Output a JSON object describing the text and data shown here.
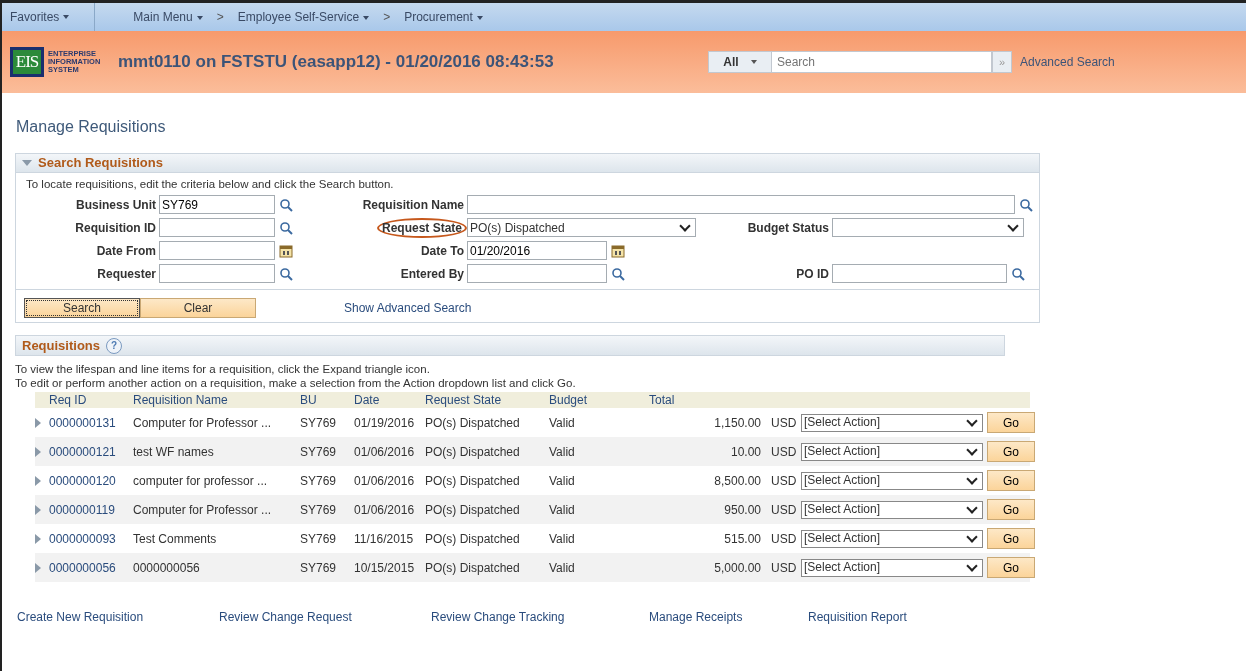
{
  "nav": {
    "favorites": "Favorites",
    "breadcrumbs": [
      "Main Menu",
      "Employee Self-Service",
      "Procurement"
    ],
    "separators": [
      ">",
      ">"
    ]
  },
  "header": {
    "logo_mark": "EIS",
    "logo_lines": [
      "ENTERPRISE",
      "INFORMATION",
      "SYSTEM"
    ],
    "title": "mmt0110 on FSTSTU (easapp12) - 01/20/2016 08:43:53",
    "search_scope": "All",
    "search_placeholder": "Search",
    "search_go": "»",
    "advanced_search": "Advanced Search"
  },
  "page_title": "Manage Requisitions",
  "search_panel": {
    "title": "Search Requisitions",
    "expanded": true,
    "instructions": "To locate requisitions, edit the criteria below and click the Search button.",
    "rows": [
      [
        {
          "label": "Business Unit",
          "value": "SY769",
          "kind": "lookup",
          "highlighted": false
        },
        {
          "label": "Requisition Name",
          "kind": "lookup",
          "highlighted": false
        }
      ],
      [
        {
          "label": "Requisition ID",
          "kind": "lookup",
          "highlighted": false
        },
        {
          "label": "Request State",
          "value": "PO(s) Dispatched",
          "kind": "select",
          "highlighted": true
        },
        {
          "label": "Budget Status",
          "kind": "select",
          "highlighted": false
        }
      ],
      [
        {
          "label": "Date From",
          "kind": "date",
          "highlighted": false
        },
        {
          "label": "Date To",
          "value": "01/20/2016",
          "kind": "date",
          "highlighted": false
        }
      ],
      [
        {
          "label": "Requester",
          "kind": "lookup",
          "highlighted": false
        },
        {
          "label": "Entered By",
          "kind": "lookup",
          "highlighted": false
        },
        {
          "label": "PO ID",
          "kind": "lookup",
          "highlighted": false
        }
      ]
    ],
    "buttons": [
      "Search",
      "Clear"
    ],
    "advanced_link": "Show Advanced Search"
  },
  "requisitions": {
    "title": "Requisitions",
    "help": "?",
    "instructions": [
      "To view the lifespan and line items for a requisition, click the Expand triangle icon.",
      "To edit or perform another action on a requisition, make a selection from the Action dropdown list and click Go."
    ],
    "columns": [
      "Req ID",
      "Requisition Name",
      "BU",
      "Date",
      "Request State",
      "Budget",
      "Total"
    ],
    "rows": [
      {
        "req_id": "0000000131",
        "name": "Computer for Professor ...",
        "bu": "SY769",
        "date": "01/19/2016",
        "state": "PO(s) Dispatched",
        "budget": "Valid",
        "total": "1,150.00",
        "currency": "USD",
        "action": "[Select Action]",
        "go": "Go",
        "expanded": false
      },
      {
        "req_id": "0000000121",
        "name": "test WF names",
        "bu": "SY769",
        "date": "01/06/2016",
        "state": "PO(s) Dispatched",
        "budget": "Valid",
        "total": "10.00",
        "currency": "USD",
        "action": "[Select Action]",
        "go": "Go",
        "expanded": false
      },
      {
        "req_id": "0000000120",
        "name": "computer for professor ...",
        "bu": "SY769",
        "date": "01/06/2016",
        "state": "PO(s) Dispatched",
        "budget": "Valid",
        "total": "8,500.00",
        "currency": "USD",
        "action": "[Select Action]",
        "go": "Go",
        "expanded": false
      },
      {
        "req_id": "0000000119",
        "name": "Computer for Professor ...",
        "bu": "SY769",
        "date": "01/06/2016",
        "state": "PO(s) Dispatched",
        "budget": "Valid",
        "total": "950.00",
        "currency": "USD",
        "action": "[Select Action]",
        "go": "Go",
        "expanded": false
      },
      {
        "req_id": "0000000093",
        "name": "Test Comments",
        "bu": "SY769",
        "date": "11/16/2015",
        "state": "PO(s) Dispatched",
        "budget": "Valid",
        "total": "515.00",
        "currency": "USD",
        "action": "[Select Action]",
        "go": "Go",
        "expanded": false
      },
      {
        "req_id": "0000000056",
        "name": "0000000056",
        "bu": "SY769",
        "date": "10/15/2015",
        "state": "PO(s) Dispatched",
        "budget": "Valid",
        "total": "5,000.00",
        "currency": "USD",
        "action": "[Select Action]",
        "go": "Go",
        "expanded": false
      }
    ]
  },
  "footer_links": [
    "Create New Requisition",
    "Review Change Request",
    "Review Change Tracking",
    "Manage Receipts",
    "Requisition Report"
  ]
}
